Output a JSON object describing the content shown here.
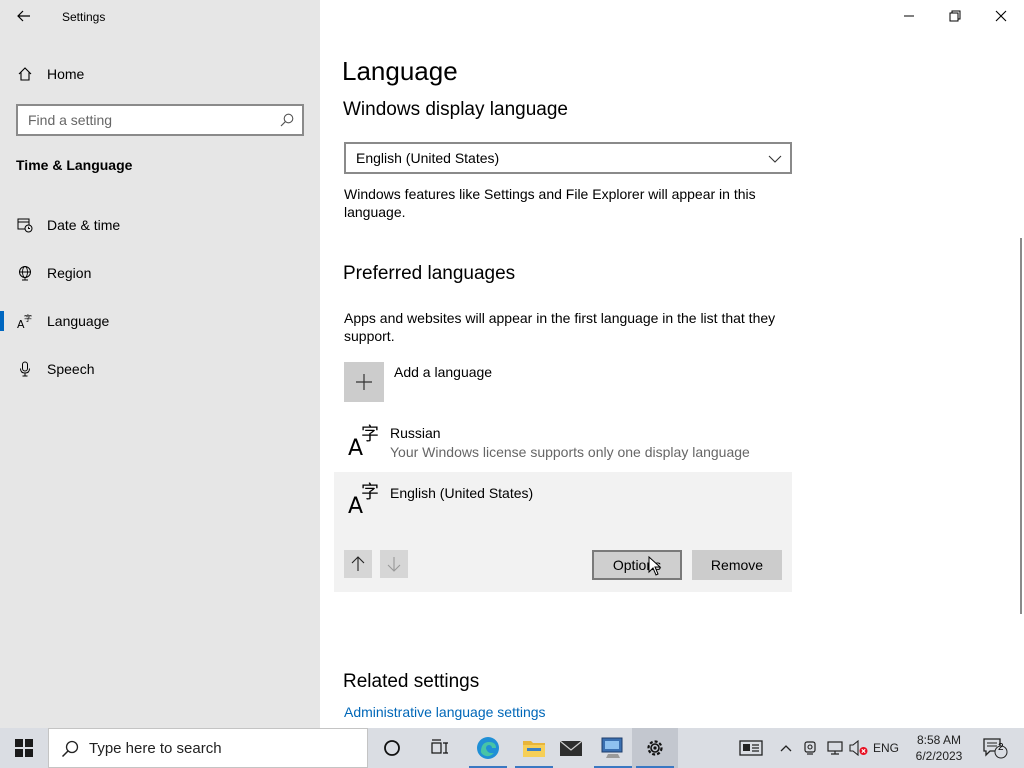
{
  "window": {
    "title": "Settings"
  },
  "sidebar": {
    "home_label": "Home",
    "search_placeholder": "Find a setting",
    "section_title": "Time & Language",
    "items": [
      {
        "label": "Date & time",
        "icon": "calendar-clock-icon",
        "active": false
      },
      {
        "label": "Region",
        "icon": "globe-icon",
        "active": false
      },
      {
        "label": "Language",
        "icon": "language-icon",
        "active": true
      },
      {
        "label": "Speech",
        "icon": "microphone-icon",
        "active": false
      }
    ]
  },
  "main": {
    "page_title": "Language",
    "display_language": {
      "heading": "Windows display language",
      "selected": "English (United States)",
      "description": "Windows features like Settings and File Explorer will appear in this language."
    },
    "preferred": {
      "heading": "Preferred languages",
      "description": "Apps and websites will appear in the first language in the list that they support.",
      "add_label": "Add a language",
      "languages": [
        {
          "name": "Russian",
          "note": "Your Windows license supports only one display language"
        },
        {
          "name": "English (United States)",
          "note": ""
        }
      ],
      "options_label": "Options",
      "remove_label": "Remove"
    },
    "related": {
      "heading": "Related settings",
      "link": "Administrative language settings"
    }
  },
  "taskbar": {
    "search_placeholder": "Type here to search",
    "language": "ENG",
    "time": "8:58 AM",
    "date": "6/2/2023",
    "notification_count": "2"
  },
  "colors": {
    "accent": "#0067c0",
    "link": "#0067b8",
    "sidebar_bg": "#e6e6e6"
  }
}
